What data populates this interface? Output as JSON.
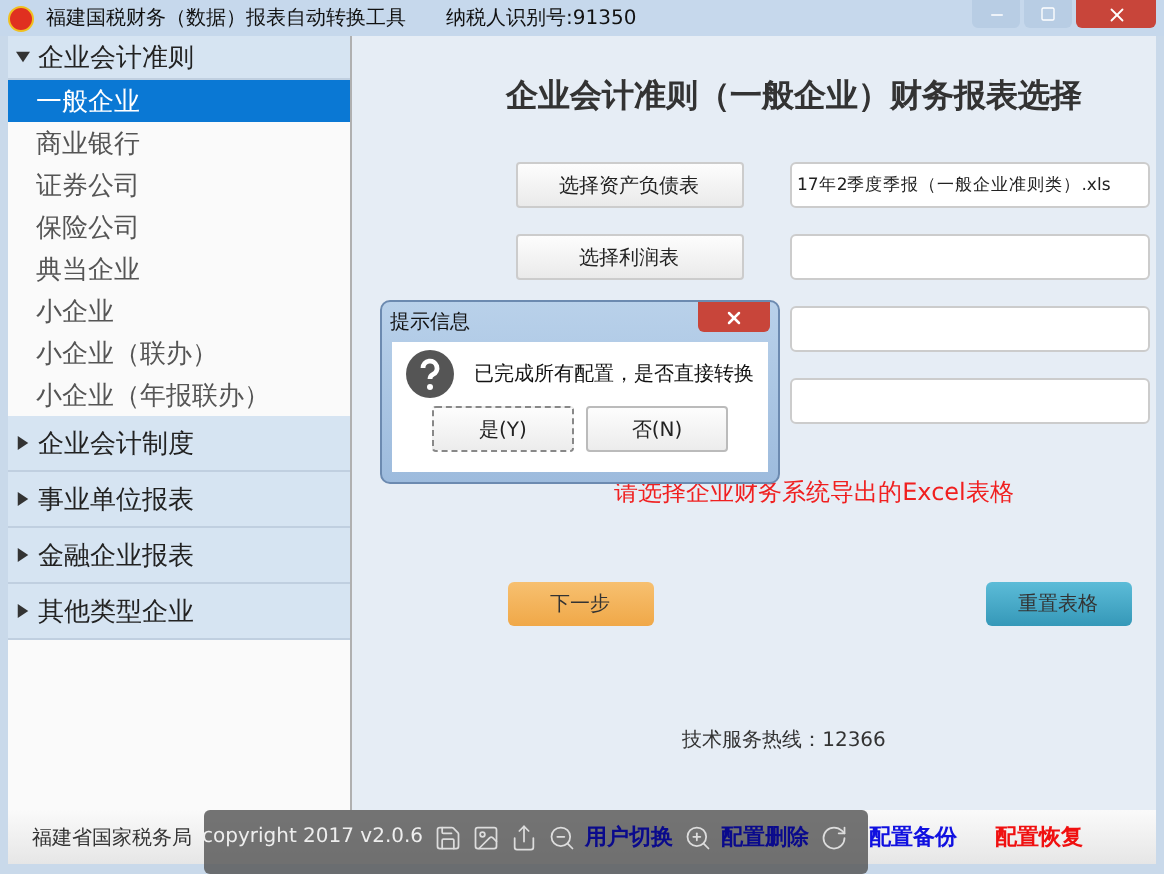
{
  "window": {
    "title": "福建国税财务（数据）报表自动转换工具",
    "taxpayer_id": "纳税人识别号:91350"
  },
  "sidebar": {
    "groups": [
      {
        "label": "企业会计准则",
        "expanded": true,
        "items": [
          {
            "label": "一般企业",
            "selected": true
          },
          {
            "label": "商业银行",
            "selected": false
          },
          {
            "label": "证券公司",
            "selected": false
          },
          {
            "label": "保险公司",
            "selected": false
          },
          {
            "label": "典当企业",
            "selected": false
          },
          {
            "label": "小企业",
            "selected": false
          },
          {
            "label": "小企业（联办）",
            "selected": false
          },
          {
            "label": "小企业（年报联办）",
            "selected": false
          }
        ]
      },
      {
        "label": "企业会计制度",
        "expanded": false
      },
      {
        "label": "事业单位报表",
        "expanded": false
      },
      {
        "label": "金融企业报表",
        "expanded": false
      },
      {
        "label": "其他类型企业",
        "expanded": false
      }
    ]
  },
  "main": {
    "heading": "企业会计准则（一般企业）财务报表选择",
    "file_rows": [
      {
        "button": "选择资产负债表",
        "value": "17年2季度季报（一般企业准则类）.xls"
      },
      {
        "button": "选择利润表",
        "value": ""
      },
      {
        "value": ""
      },
      {
        "value": ""
      }
    ],
    "hint": "请选择企业财务系统导出的Excel表格",
    "next_button": "下一步",
    "reset_button": "重置表格",
    "hotline": "技术服务热线：12366"
  },
  "dialog": {
    "title": "提示信息",
    "message": "已完成所有配置，是否直接转换",
    "buttons": [
      {
        "label": "是(Y)",
        "focused": true
      },
      {
        "label": "否(N)",
        "focused": false
      }
    ]
  },
  "footer": {
    "org": "福建省国家税务局",
    "copyright": "copyright 2017  v2.0.6",
    "links": [
      {
        "label": "用户切换",
        "color": "#0a0a8c"
      },
      {
        "label": "配置删除",
        "color": "#0a0a8c"
      },
      {
        "label": "配置备份",
        "color": "#1010e0"
      },
      {
        "label": "配置恢复",
        "color": "#f01010"
      }
    ]
  }
}
